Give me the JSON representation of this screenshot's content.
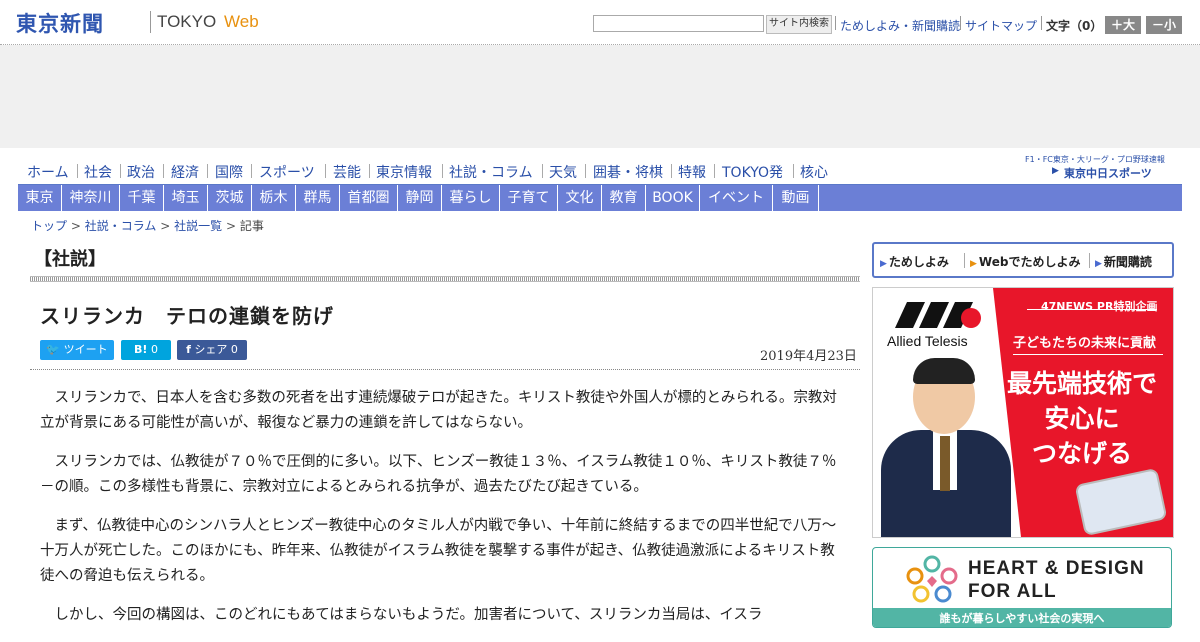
{
  "header": {
    "logo_text": "東京新聞",
    "logo_tokyo": "TOKYO",
    "logo_web": "Web",
    "search_placeholder": "",
    "search_button": "サイト内検索",
    "links": [
      "ためしよみ・新聞購読",
      "サイトマップ"
    ],
    "font_size_label": "文字（0）",
    "font_bigger": "＋大",
    "font_smaller": "－小"
  },
  "main_nav": [
    "ホーム",
    "社会",
    "政治",
    "経済",
    "国際",
    "スポーツ",
    "芸能",
    "東京情報",
    "社説・コラム",
    "天気",
    "囲碁・将棋",
    "特報",
    "TOKYO発",
    "核心"
  ],
  "sports_banner": {
    "top": "F1・FC東京・大リーグ・プロ野球速報",
    "logo": "東京中日スポーツ"
  },
  "regional_nav": [
    "東京",
    "神奈川",
    "千葉",
    "埼玉",
    "茨城",
    "栃木",
    "群馬",
    "首都圏",
    "静岡",
    "暮らし",
    "子育て",
    "文化",
    "教育",
    "BOOK",
    "イベント",
    "動画"
  ],
  "breadcrumb": {
    "items": [
      "トップ",
      "社説・コラム",
      "社説一覧"
    ],
    "current": "記事",
    "sep": ">"
  },
  "article": {
    "section": "【社説】",
    "headline": "スリランカ　テロの連鎖を防げ",
    "date": "2019年4月23日",
    "share": {
      "tweet_label": "ツイート",
      "hatena_label": "B!",
      "hatena_count": "0",
      "fb_label": "シェア",
      "fb_count": "0"
    },
    "paragraphs": [
      "スリランカで、日本人を含む多数の死者を出す連続爆破テロが起きた。キリスト教徒や外国人が標的とみられる。宗教対立が背景にある可能性が高いが、報復など暴力の連鎖を許してはならない。",
      "スリランカでは、仏教徒が７０％で圧倒的に多い。以下、ヒンズー教徒１３％、イスラム教徒１０％、キリスト教徒７％－の順。この多様性も背景に、宗教対立によるとみられる抗争が、過去たびたび起きている。",
      "まず、仏教徒中心のシンハラ人とヒンズー教徒中心のタミル人が内戦で争い、十年前に終結するまでの四半世紀で八万～十万人が死亡した。このほかにも、昨年来、仏教徒がイスラム教徒を襲撃する事件が起き、仏教徒過激派によるキリスト教徒への脅迫も伝えられる。",
      "しかし、今回の構図は、このどれにもあてはまらないもようだ。加害者について、スリランカ当局は、イスラ"
    ]
  },
  "sidebar": {
    "subscribe": [
      "ためしよみ",
      "Webでためしよみ",
      "新聞購読"
    ],
    "ad1": {
      "brand": "Allied Telesis",
      "tag": "47NEWS PR特別企画",
      "subtitle": "子どもたちの未来に貢献",
      "headline_lines": [
        "最先端技術で",
        "安心に",
        "つなげる"
      ],
      "accent_color": "#e8162a"
    },
    "ad2": {
      "title_line1": "HEART & DESIGN",
      "title_line2": "FOR ALL",
      "caption": "誰もが暮らしやすい社会の実現へ",
      "accent_color": "#52b5a5"
    }
  },
  "colors": {
    "brand_blue": "#2f56b0",
    "nav_bar": "#6b7fd6",
    "web_orange": "#e8910f"
  }
}
